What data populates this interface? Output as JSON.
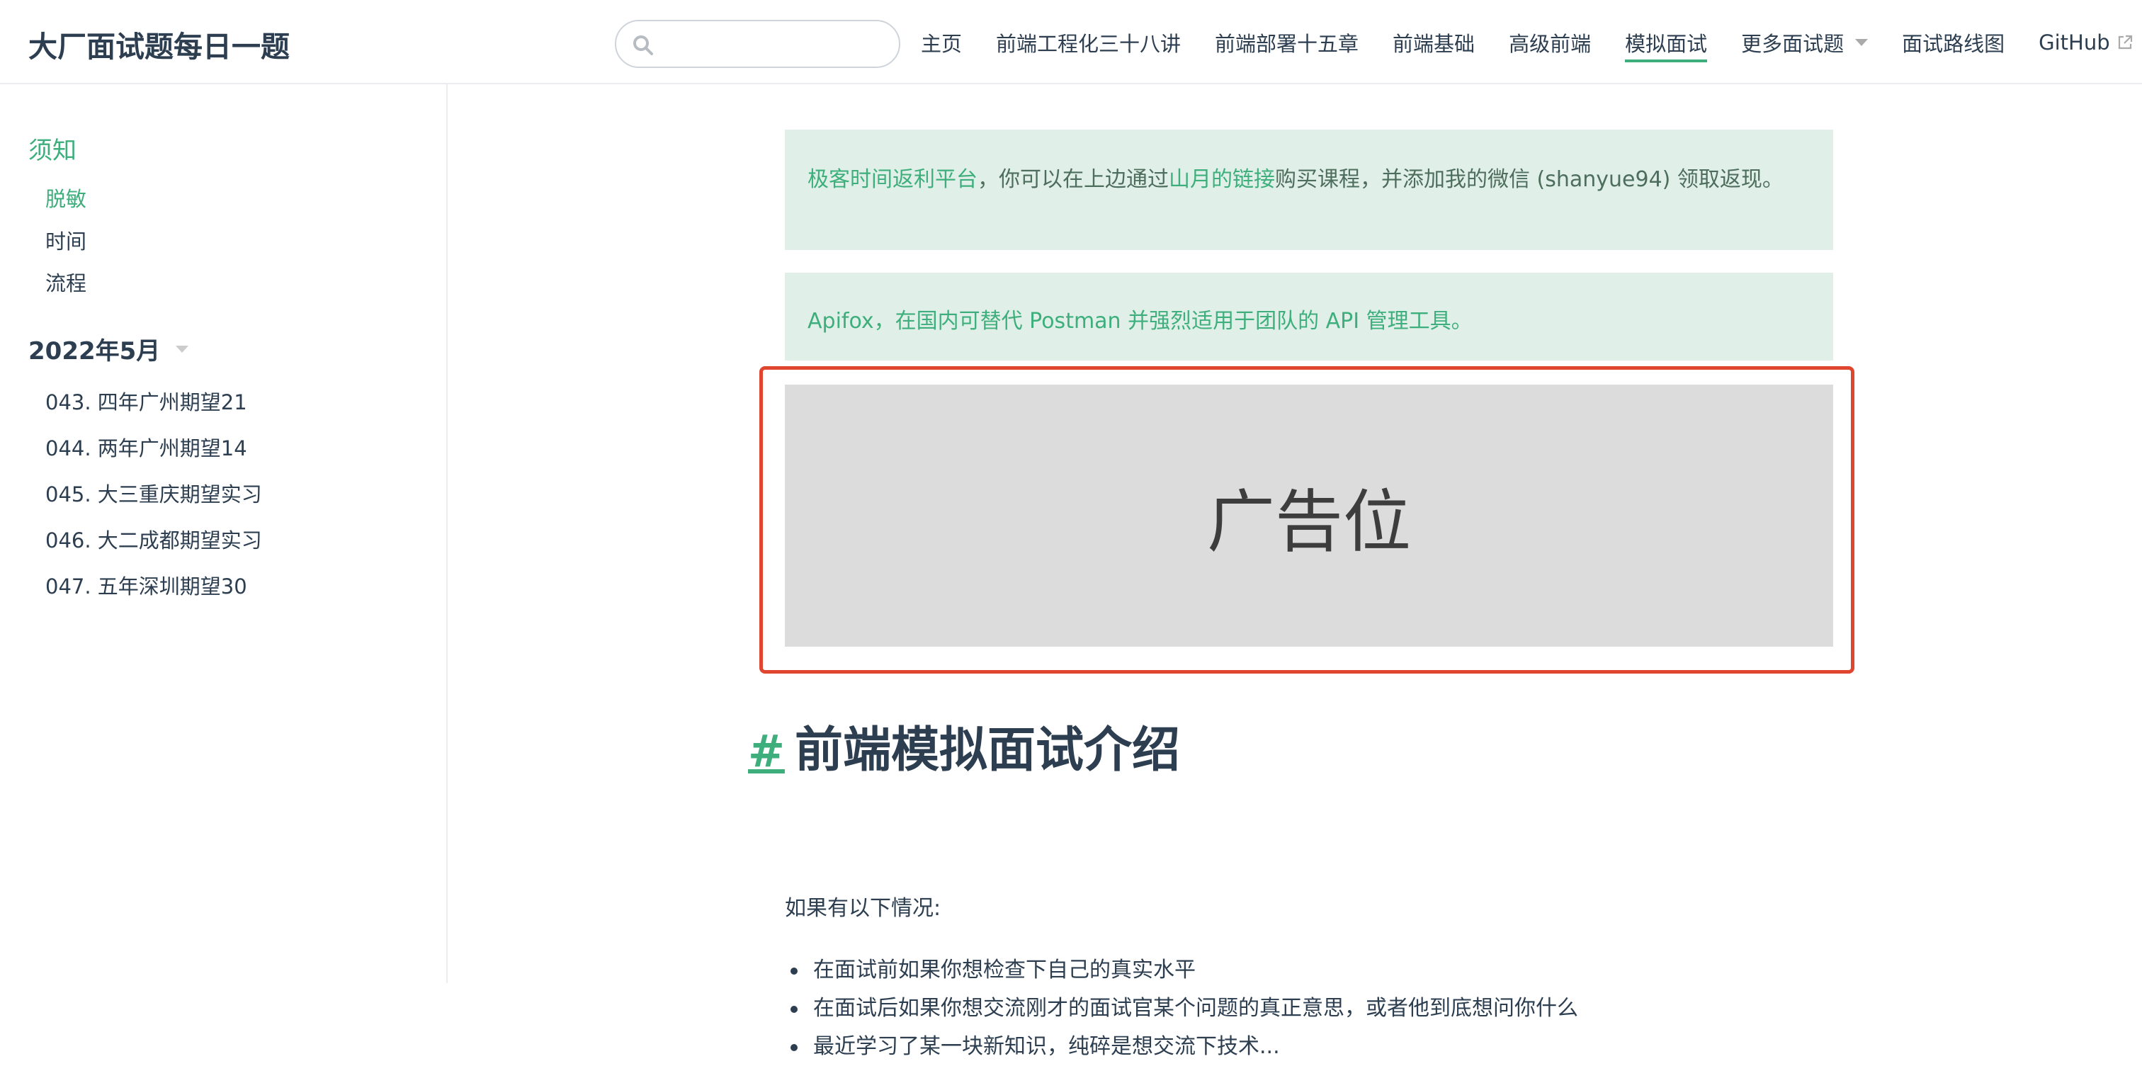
{
  "header": {
    "site_title": "大厂面试题每日一题",
    "search": {
      "value": "",
      "placeholder": ""
    },
    "nav": [
      {
        "label": "主页"
      },
      {
        "label": "前端工程化三十八讲"
      },
      {
        "label": "前端部署十五章"
      },
      {
        "label": "前端基础"
      },
      {
        "label": "高级前端"
      },
      {
        "label": "模拟面试",
        "active": true
      },
      {
        "label": "更多面试题",
        "dropdown": true
      },
      {
        "label": "面试路线图"
      },
      {
        "label": "GitHub",
        "external": true
      }
    ]
  },
  "sidebar": {
    "group_title": "须知",
    "group_items": [
      {
        "label": "脱敏",
        "active": true
      },
      {
        "label": "时间"
      },
      {
        "label": "流程"
      }
    ],
    "section_title": "2022年5月",
    "section_items": [
      {
        "label": "043. 四年广州期望21"
      },
      {
        "label": "044. 两年广州期望14"
      },
      {
        "label": "045. 大三重庆期望实习"
      },
      {
        "label": "046. 大二成都期望实习"
      },
      {
        "label": "047. 五年深圳期望30"
      }
    ]
  },
  "main": {
    "tip1": {
      "link1": "极客时间返利平台",
      "text1": "，你可以在上边通过",
      "link2": "山月的链接",
      "text2": "购买课程，并添加我的微信 (shanyue94) 领取返现。"
    },
    "tip2": {
      "text": "Apifox，在国内可替代 Postman 并强烈适用于团队的 API 管理工具。"
    },
    "ad_label": "广告位",
    "heading_hash": "#",
    "heading": "前端模拟面试介绍",
    "intro": "如果有以下情况:",
    "bullets": [
      "在面试前如果你想检查下自己的真实水平",
      "在面试后如果你想交流刚才的面试官某个问题的真正意思，或者他到底想问你什么",
      "最近学习了某一块新知识，纯碎是想交流下技术..."
    ]
  },
  "colors": {
    "accent": "#3eaf7c",
    "tip_bg": "#e0f0e8",
    "ad_bg": "#dcdcdc",
    "ad_border": "#e0452f",
    "text": "#2c3e50"
  }
}
